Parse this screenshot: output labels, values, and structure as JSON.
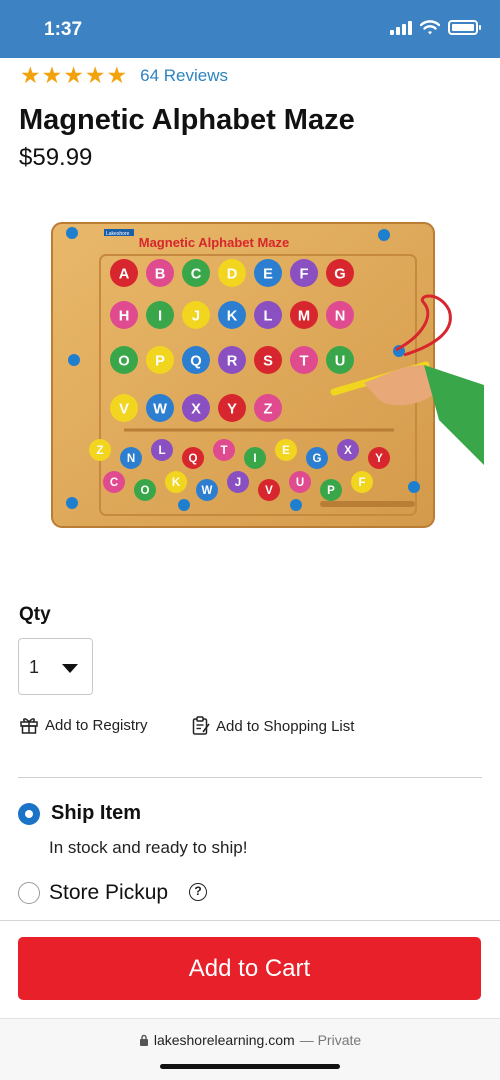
{
  "status_bar": {
    "time": "1:37",
    "signal_icon": "cellular-signal-icon",
    "wifi_icon": "wifi-icon",
    "battery_icon": "battery-icon"
  },
  "product": {
    "stars": "★★★★★",
    "rating": 5,
    "reviews_label": "64 Reviews",
    "title": "Magnetic Alphabet Maze",
    "price": "$59.99",
    "image": {
      "board_title": "Magnetic Alphabet Maze",
      "brand": "Lakeshore",
      "rows": [
        [
          "A",
          "B",
          "C",
          "D",
          "E",
          "F",
          "G"
        ],
        [
          "H",
          "I",
          "J",
          "K",
          "L",
          "M",
          "N"
        ],
        [
          "O",
          "P",
          "Q",
          "R",
          "S",
          "T",
          "U"
        ],
        [
          "V",
          "W",
          "X",
          "Y",
          "Z"
        ]
      ],
      "loose_letters": [
        "Z",
        "N",
        "L",
        "Q",
        "T",
        "I",
        "E",
        "G",
        "X",
        "Y",
        "C",
        "O",
        "K",
        "W",
        "J",
        "V",
        "U",
        "P",
        "F"
      ]
    }
  },
  "qty": {
    "label": "Qty",
    "value": "1"
  },
  "actions": {
    "registry": "Add to Registry",
    "shopping_list": "Add to Shopping List"
  },
  "fulfillment": {
    "ship_label": "Ship Item",
    "ship_status": "In stock and ready to ship!",
    "pickup_label": "Store Pickup",
    "help_glyph": "?"
  },
  "cart": {
    "button_label": "Add to Cart"
  },
  "browser": {
    "domain": "lakeshorelearning.com",
    "privacy": "— Private"
  },
  "colors": {
    "brand_blue": "#3d82c3",
    "star": "#f2a20c",
    "cart_red": "#e8202a",
    "radio_blue": "#1b73c7",
    "link": "#2c84c0"
  }
}
